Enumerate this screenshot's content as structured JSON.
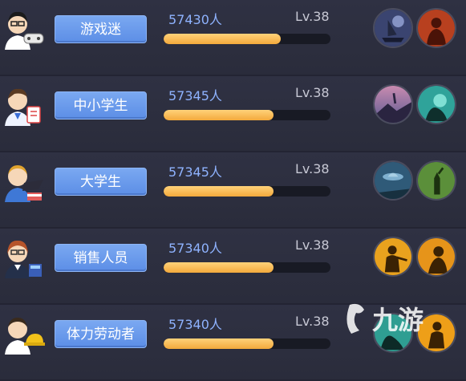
{
  "rows": [
    {
      "tag": "游戏迷",
      "count": "57430人",
      "level": "Lv.38",
      "progress": 0.7,
      "avatar_icon": "gamer-avatar-icon",
      "badges": [
        "pirate-ship-badge",
        "red-silhouette-badge"
      ]
    },
    {
      "tag": "中小学生",
      "count": "57345人",
      "level": "Lv.38",
      "progress": 0.66,
      "avatar_icon": "student-avatar-icon",
      "badges": [
        "climber-sunset-badge",
        "jungle-creature-badge"
      ]
    },
    {
      "tag": "大学生",
      "count": "57345人",
      "level": "Lv.38",
      "progress": 0.66,
      "avatar_icon": "graduate-avatar-icon",
      "badges": [
        "ufo-badge",
        "statue-badge"
      ]
    },
    {
      "tag": "销售人员",
      "count": "57340人",
      "level": "Lv.38",
      "progress": 0.66,
      "avatar_icon": "salesperson-avatar-icon",
      "badges": [
        "soldier-badge",
        "agent-silhouette-badge"
      ]
    },
    {
      "tag": "体力劳动者",
      "count": "57340人",
      "level": "Lv.38",
      "progress": 0.66,
      "avatar_icon": "worker-avatar-icon",
      "badges": [
        "jungle-badge",
        "soldier-orange-badge"
      ]
    }
  ],
  "watermark": {
    "text": "九游",
    "icon": "jiuyou-logo-icon"
  },
  "colors": {
    "accent_blue": "#6a9bec",
    "bar_orange": "#f3a93c",
    "count_blue": "#8fb3ff"
  }
}
